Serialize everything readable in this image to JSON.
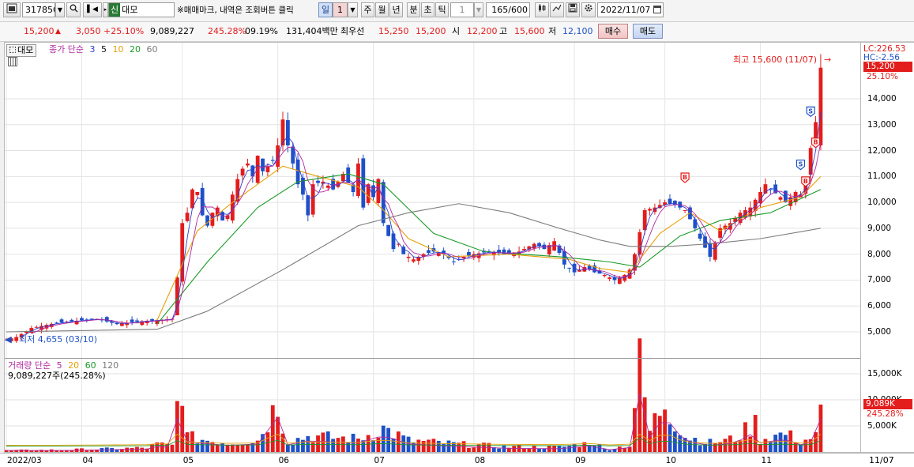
{
  "toolbar": {
    "code": "317850",
    "credit_badge": "신",
    "name_chip": "대모",
    "search_placeholder": "",
    "hint": "※매매마크, 내역은 조회버튼 클릭",
    "period_label": "일",
    "period_value": "1",
    "periods": [
      "주",
      "월",
      "년",
      "분",
      "초",
      "틱"
    ],
    "tick_value": "1",
    "count": "165",
    "count_max": "/600",
    "date": "2022/11/07"
  },
  "quote": {
    "price": "15,200",
    "change_arrow": "▲",
    "change": "3,050",
    "change_pct": "+25.10%",
    "volume": "9,089,227",
    "volume_ratio": "245.28%",
    "turnover": "09.19%",
    "amount": "131,404백만",
    "best_label": "최우선",
    "ask": "15,250",
    "bid": "15,200",
    "open_label": "시",
    "open": "12,200",
    "high_label": "고",
    "high": "15,600",
    "low_label": "저",
    "low": "12,100",
    "buy_label": "매수",
    "sell_label": "매도"
  },
  "price_panel": {
    "name_tab": "대모",
    "legend_prefix": "종가 단순",
    "ma": [
      {
        "label": "3",
        "color": "#2e3fd0"
      },
      {
        "label": "5",
        "color": "#b0289f"
      },
      {
        "label": "10",
        "color": "#e7a008"
      },
      {
        "label": "20",
        "color": "#1b9a28"
      },
      {
        "label": "60",
        "color": "#7b7b7b"
      }
    ],
    "high_note": "최고 15,600 (11/07)",
    "low_note": "최저 4,655 (03/10)",
    "lc": "LC:226.53",
    "hc": "HC:-2.56",
    "last_price_tag": "15,200",
    "last_pct_tag": "25.10%",
    "y_ticks": [
      "14,000",
      "13,000",
      "12,000",
      "11,000",
      "10,000",
      "9,000",
      "8,000",
      "7,000",
      "6,000",
      "5,000"
    ],
    "y_values": [
      14000,
      13000,
      12000,
      11000,
      10000,
      9000,
      8000,
      7000,
      6000,
      5000
    ],
    "marks": [
      {
        "date_index": 160,
        "label": "S",
        "type": "sell",
        "price": 13500
      },
      {
        "date_index": 161,
        "label": "B",
        "type": "buy",
        "price": 12300
      },
      {
        "date_index": 158,
        "label": "S",
        "type": "sell",
        "price": 11450
      },
      {
        "date_index": 159,
        "label": "B",
        "type": "buy",
        "price": 10800
      },
      {
        "date_index": 135,
        "label": "B",
        "type": "buy",
        "price": 10950
      }
    ]
  },
  "volume_panel": {
    "legend_prefix": "거래량 단순",
    "ma": [
      {
        "label": "5",
        "color": "#b0289f"
      },
      {
        "label": "20",
        "color": "#e7a008"
      },
      {
        "label": "60",
        "color": "#1b9a28"
      },
      {
        "label": "120",
        "color": "#7b7b7b"
      }
    ],
    "volume_readout": "9,089,227주(245.28%)",
    "y_ticks": [
      "15,000K",
      "10,000K",
      "5,000K"
    ],
    "y_values": [
      15000,
      10000,
      5000
    ],
    "last_volume_tag": "9,089K",
    "last_pct_tag": "245.28%"
  },
  "x_axis": {
    "labels": [
      "2022/03",
      "04",
      "05",
      "06",
      "07",
      "08",
      "09",
      "10",
      "11"
    ],
    "label_index": [
      0,
      15,
      35,
      54,
      73,
      93,
      113,
      131,
      150
    ],
    "right_label": "11/07"
  },
  "chart_data": {
    "type": "candlestick",
    "title": "",
    "period": "daily",
    "x_range": [
      "2022/03/03",
      "2022/11/07"
    ],
    "bars": 165,
    "ylim": [
      4500,
      16000
    ],
    "volume_ylim": [
      0,
      17000
    ],
    "up_color": "#e31c1c",
    "down_color": "#1e50c8",
    "close_path": [
      [
        0,
        4700
      ],
      [
        2,
        4800
      ],
      [
        5,
        5150
      ],
      [
        10,
        5350
      ],
      [
        15,
        5450
      ],
      [
        18,
        5500
      ],
      [
        22,
        5300
      ],
      [
        26,
        5400
      ],
      [
        30,
        5450
      ],
      [
        33,
        5500
      ],
      [
        34,
        7100
      ],
      [
        35,
        9200
      ],
      [
        36,
        9600
      ],
      [
        37,
        10500
      ],
      [
        38,
        10400
      ],
      [
        39,
        9500
      ],
      [
        40,
        9100
      ],
      [
        41,
        9600
      ],
      [
        42,
        9800
      ],
      [
        43,
        9300
      ],
      [
        44,
        9500
      ],
      [
        45,
        10300
      ],
      [
        46,
        10900
      ],
      [
        47,
        11300
      ],
      [
        48,
        11500
      ],
      [
        49,
        11000
      ],
      [
        50,
        11800
      ],
      [
        51,
        11200
      ],
      [
        52,
        11400
      ],
      [
        53,
        11600
      ],
      [
        54,
        12200
      ],
      [
        55,
        13200
      ],
      [
        56,
        12200
      ],
      [
        57,
        11500
      ],
      [
        58,
        10700
      ],
      [
        59,
        10300
      ],
      [
        60,
        9500
      ],
      [
        61,
        10700
      ],
      [
        63,
        10800
      ],
      [
        65,
        10500
      ],
      [
        67,
        11100
      ],
      [
        69,
        10400
      ],
      [
        70,
        11500
      ],
      [
        71,
        9800
      ],
      [
        72,
        10700
      ],
      [
        73,
        10200
      ],
      [
        74,
        10900
      ],
      [
        75,
        9200
      ],
      [
        76,
        8700
      ],
      [
        77,
        8200
      ],
      [
        78,
        8400
      ],
      [
        79,
        8000
      ],
      [
        81,
        7800
      ],
      [
        83,
        8000
      ],
      [
        85,
        8100
      ],
      [
        87,
        8000
      ],
      [
        89,
        7700
      ],
      [
        91,
        7900
      ],
      [
        93,
        8000
      ],
      [
        96,
        8100
      ],
      [
        99,
        8000
      ],
      [
        102,
        8100
      ],
      [
        105,
        8400
      ],
      [
        107,
        8200
      ],
      [
        109,
        8500
      ],
      [
        111,
        7600
      ],
      [
        113,
        7300
      ],
      [
        115,
        7500
      ],
      [
        117,
        7300
      ],
      [
        119,
        7200
      ],
      [
        121,
        7000
      ],
      [
        123,
        7200
      ],
      [
        124,
        7400
      ],
      [
        125,
        8000
      ],
      [
        127,
        9700
      ],
      [
        129,
        9800
      ],
      [
        131,
        10000
      ],
      [
        133,
        9900
      ],
      [
        135,
        9700
      ],
      [
        137,
        9000
      ],
      [
        138,
        8600
      ],
      [
        140,
        7900
      ],
      [
        142,
        9000
      ],
      [
        144,
        9200
      ],
      [
        146,
        9600
      ],
      [
        148,
        9800
      ],
      [
        149,
        10100
      ],
      [
        151,
        10700
      ],
      [
        152,
        10500
      ],
      [
        154,
        10200
      ],
      [
        155,
        10000
      ],
      [
        157,
        10400
      ],
      [
        158,
        10300
      ],
      [
        159,
        10800
      ],
      [
        160,
        12100
      ],
      [
        161,
        13100
      ],
      [
        162,
        15200
      ]
    ],
    "ma_paths": {
      "10": [
        [
          30,
          5450
        ],
        [
          38,
          8900
        ],
        [
          45,
          10000
        ],
        [
          55,
          11400
        ],
        [
          62,
          11000
        ],
        [
          70,
          10600
        ],
        [
          75,
          9700
        ],
        [
          80,
          8600
        ],
        [
          88,
          7900
        ],
        [
          100,
          8000
        ],
        [
          112,
          7800
        ],
        [
          118,
          7450
        ],
        [
          124,
          7300
        ],
        [
          130,
          8800
        ],
        [
          136,
          9600
        ],
        [
          142,
          8900
        ],
        [
          150,
          9800
        ],
        [
          158,
          10200
        ],
        [
          162,
          11000
        ]
      ],
      "20": [
        [
          30,
          5300
        ],
        [
          40,
          7700
        ],
        [
          50,
          9800
        ],
        [
          58,
          10800
        ],
        [
          68,
          11100
        ],
        [
          75,
          10700
        ],
        [
          85,
          8800
        ],
        [
          95,
          8100
        ],
        [
          110,
          7900
        ],
        [
          120,
          7700
        ],
        [
          126,
          7500
        ],
        [
          134,
          8700
        ],
        [
          142,
          9300
        ],
        [
          152,
          9600
        ],
        [
          162,
          10500
        ]
      ],
      "60": [
        [
          0,
          5000
        ],
        [
          30,
          5100
        ],
        [
          40,
          5800
        ],
        [
          55,
          7400
        ],
        [
          70,
          9100
        ],
        [
          80,
          9600
        ],
        [
          90,
          9950
        ],
        [
          100,
          9600
        ],
        [
          110,
          9000
        ],
        [
          118,
          8550
        ],
        [
          124,
          8300
        ],
        [
          132,
          8300
        ],
        [
          140,
          8400
        ],
        [
          150,
          8600
        ],
        [
          162,
          9000
        ]
      ]
    },
    "volume_path_k": [
      [
        0,
        300
      ],
      [
        10,
        400
      ],
      [
        20,
        600
      ],
      [
        28,
        800
      ],
      [
        30,
        1500
      ],
      [
        33,
        1200
      ],
      [
        34,
        9000
      ],
      [
        35,
        15000
      ],
      [
        36,
        3000
      ],
      [
        38,
        2500
      ],
      [
        44,
        1800
      ],
      [
        50,
        2200
      ],
      [
        54,
        9500
      ],
      [
        56,
        2000
      ],
      [
        60,
        3000
      ],
      [
        70,
        2500
      ],
      [
        75,
        4500
      ],
      [
        80,
        2200
      ],
      [
        90,
        1500
      ],
      [
        100,
        1000
      ],
      [
        110,
        900
      ],
      [
        117,
        1800
      ],
      [
        119,
        500
      ],
      [
        124,
        1200
      ],
      [
        125,
        9000
      ],
      [
        126,
        16000
      ],
      [
        128,
        4000
      ],
      [
        131,
        10000
      ],
      [
        133,
        6000
      ],
      [
        135,
        3000
      ],
      [
        140,
        1800
      ],
      [
        145,
        2500
      ],
      [
        149,
        5500
      ],
      [
        150,
        2500
      ],
      [
        155,
        3500
      ],
      [
        158,
        2000
      ],
      [
        161,
        3000
      ],
      [
        162,
        9089
      ]
    ],
    "highest": {
      "value": 15600,
      "date": "11/07"
    },
    "lowest": {
      "value": 4655,
      "date": "03/10"
    }
  }
}
